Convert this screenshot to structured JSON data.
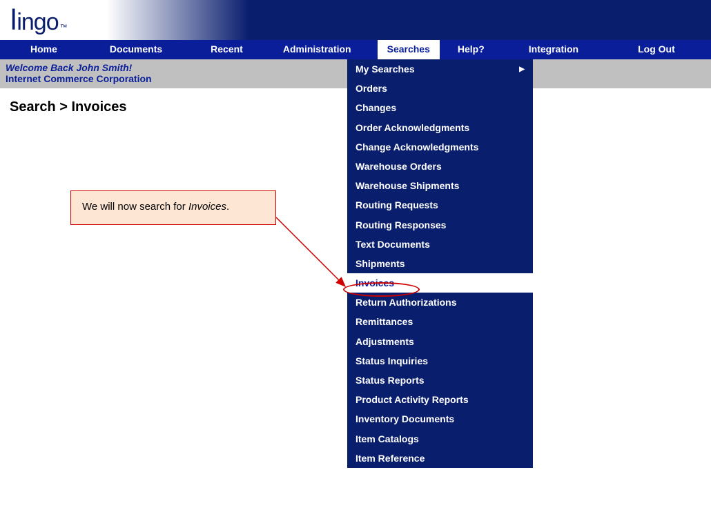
{
  "logo": {
    "l": "l",
    "rest": "ingo",
    "tm": "™"
  },
  "nav": {
    "items": [
      {
        "label": "Home"
      },
      {
        "label": "Documents"
      },
      {
        "label": "Recent"
      },
      {
        "label": "Administration"
      },
      {
        "label": "Searches",
        "active": true
      },
      {
        "label": "Help?"
      },
      {
        "label": "Integration"
      },
      {
        "label": "Log Out"
      }
    ]
  },
  "welcome": {
    "greeting": "Welcome Back John Smith!",
    "company": "Internet Commerce Corporation"
  },
  "breadcrumb": "Search > Invoices",
  "dropdown": {
    "items": [
      {
        "label": "My Searches",
        "submenu": true
      },
      {
        "label": "Orders"
      },
      {
        "label": "Changes"
      },
      {
        "label": "Order Acknowledgments"
      },
      {
        "label": "Change Acknowledgments"
      },
      {
        "label": "Warehouse Orders"
      },
      {
        "label": "Warehouse Shipments"
      },
      {
        "label": "Routing Requests"
      },
      {
        "label": "Routing Responses"
      },
      {
        "label": "Text Documents"
      },
      {
        "label": "Shipments"
      },
      {
        "label": "Invoices",
        "highlighted": true
      },
      {
        "label": "Return Authorizations"
      },
      {
        "label": "Remittances"
      },
      {
        "label": "Adjustments"
      },
      {
        "label": "Status Inquiries"
      },
      {
        "label": "Status Reports"
      },
      {
        "label": "Product Activity Reports"
      },
      {
        "label": "Inventory Documents"
      },
      {
        "label": "Item Catalogs"
      },
      {
        "label": "Item Reference"
      }
    ]
  },
  "callout": {
    "prefix": "We will now search for ",
    "emphasis": "Invoices",
    "suffix": "."
  }
}
